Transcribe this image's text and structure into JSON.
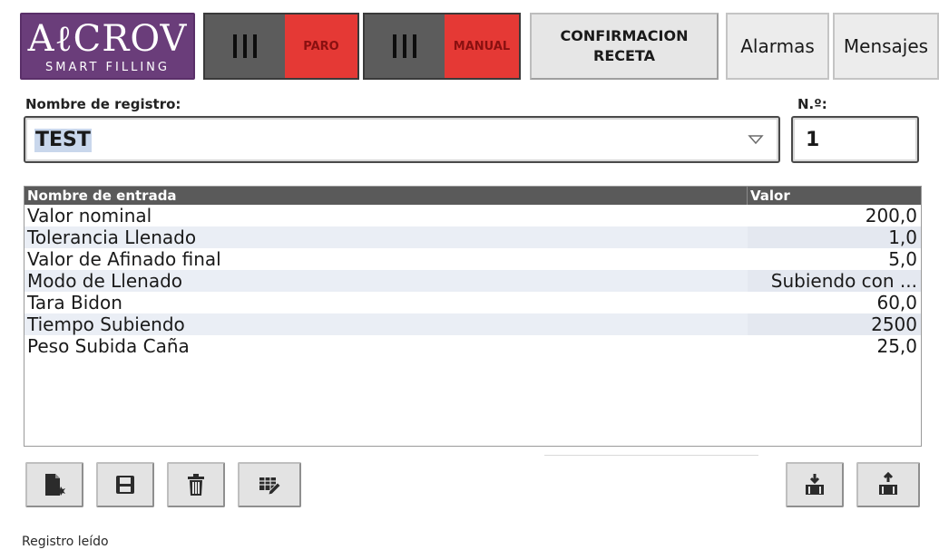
{
  "header": {
    "logo_main": "AℓCROV",
    "logo_sub": "SMART FILLING",
    "status_1": {
      "label": "PARO"
    },
    "status_2": {
      "label": "MANUAL"
    },
    "confirm_button_line1": "CONFIRMACION",
    "confirm_button_line2": "RECETA",
    "tab_alarms": "Alarmas",
    "tab_messages": "Mensajes"
  },
  "record": {
    "name_label": "Nombre de registro:",
    "name_value": "TEST",
    "number_label": "N.º:",
    "number_value": "1"
  },
  "table": {
    "col_name": "Nombre de entrada",
    "col_value": "Valor",
    "rows": [
      {
        "name": "Valor nominal",
        "value": "200,0"
      },
      {
        "name": "Tolerancia Llenado",
        "value": "1,0"
      },
      {
        "name": "Valor de Afinado final",
        "value": "5,0"
      },
      {
        "name": "Modo de Llenado",
        "value": "Subiendo con ..."
      },
      {
        "name": "Tara Bidon",
        "value": "60,0"
      },
      {
        "name": "Tiempo Subiendo",
        "value": "2500"
      },
      {
        "name": "Peso Subida Caña",
        "value": "25,0"
      }
    ]
  },
  "toolbar": {
    "icons": [
      "new-record-icon",
      "save-icon",
      "delete-icon",
      "edit-table-icon",
      "import-icon",
      "export-icon"
    ]
  },
  "status_text": "Registro leído",
  "colors": {
    "brand_purple": "#6a3d7a",
    "alarm_red": "#e53935",
    "table_header": "#5a5a5a",
    "alt_row": "#eaeef5"
  }
}
